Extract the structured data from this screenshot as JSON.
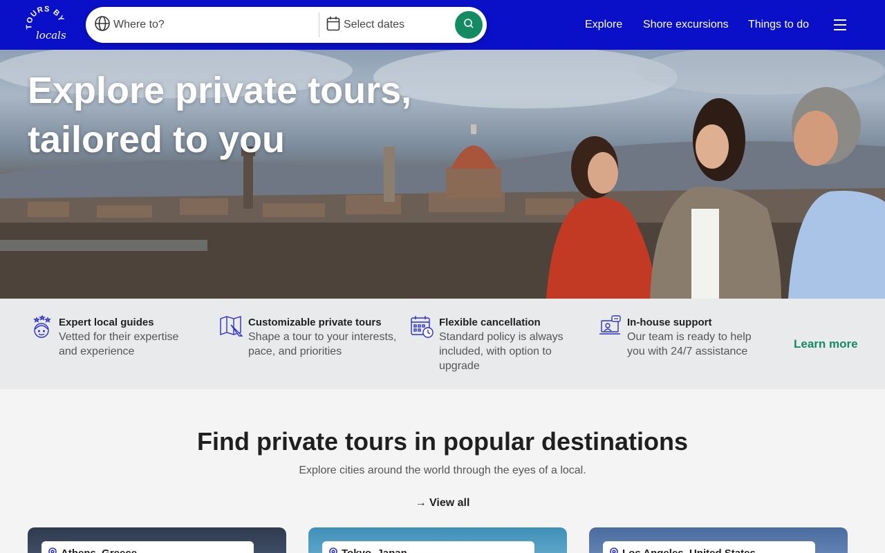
{
  "brand": {
    "logo_text_top": "TOURS BY",
    "logo_text_bottom": "locals",
    "colors": {
      "header": "#0a10c8",
      "accent": "#138a62"
    }
  },
  "search": {
    "where_placeholder": "Where to?",
    "dates_placeholder": "Select dates",
    "where_icon": "globe-icon",
    "dates_icon": "calendar-icon",
    "submit_icon": "search-icon"
  },
  "nav": {
    "items": [
      "Explore",
      "Shore excursions",
      "Things to do"
    ],
    "menu_icon": "hamburger-menu-icon"
  },
  "hero": {
    "title_line1": "Explore private tours,",
    "title_line2": "tailored to you"
  },
  "features": [
    {
      "icon": "guide-stars-icon",
      "title": "Expert local guides",
      "desc": "Vetted for their expertise and experience"
    },
    {
      "icon": "map-pencil-icon",
      "title": "Customizable private tours",
      "desc": "Shape a tour to your interests, pace, and priorities"
    },
    {
      "icon": "calendar-clock-icon",
      "title": "Flexible cancellation",
      "desc": "Standard policy is always included, with option to upgrade"
    },
    {
      "icon": "support-chat-icon",
      "title": "In-house support",
      "desc": "Our team is ready to help you with 24/7 assistance"
    }
  ],
  "learn_more": "Learn more",
  "destinations": {
    "title": "Find private tours in popular destinations",
    "subtitle": "Explore cities around the world through the eyes of a local.",
    "view_all": "→ View all",
    "cards": [
      {
        "label": "Athens, Greece"
      },
      {
        "label": "Tokyo, Japan"
      },
      {
        "label": "Los Angeles, United States"
      }
    ]
  }
}
